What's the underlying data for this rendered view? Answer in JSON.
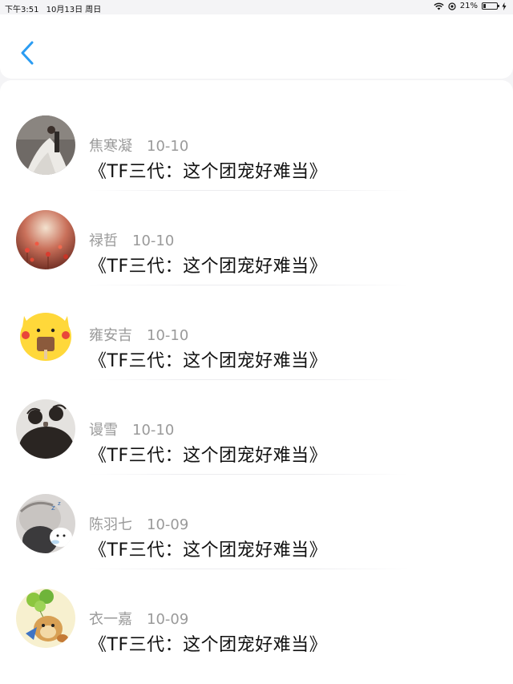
{
  "status_bar": {
    "time": "下午3:51",
    "date": "10月13日 周日",
    "battery_percent": "21%",
    "battery_level": 0.21,
    "icons": [
      "wifi-icon",
      "location-lock-icon",
      "battery-icon",
      "charging-icon"
    ]
  },
  "nav": {
    "back_icon": "chevron-left-icon"
  },
  "colors": {
    "accent": "#2b9cf2",
    "meta_text": "#9a9a9a",
    "title_text": "#111111"
  },
  "comments": [
    {
      "author": "焦寒凝",
      "date": "10-10",
      "title": "《TF三代：这个团宠好难当》",
      "avatar": "bride-photo"
    },
    {
      "author": "禄哲",
      "date": "10-10",
      "title": "《TF三代：这个团宠好难当》",
      "avatar": "red-flowers"
    },
    {
      "author": "雍安吉",
      "date": "10-10",
      "title": "《TF三代：这个团宠好难当》",
      "avatar": "yellow-cartoon"
    },
    {
      "author": "谩雪",
      "date": "10-10",
      "title": "《TF三代：这个团宠好难当》",
      "avatar": "hair-buns"
    },
    {
      "author": "陈羽七",
      "date": "10-09",
      "title": "《TF三代：这个团宠好难当》",
      "avatar": "sleeping-sticker"
    },
    {
      "author": "衣一嘉",
      "date": "10-09",
      "title": "《TF三代：这个团宠好难当》",
      "avatar": "balloon-cartoon"
    }
  ]
}
